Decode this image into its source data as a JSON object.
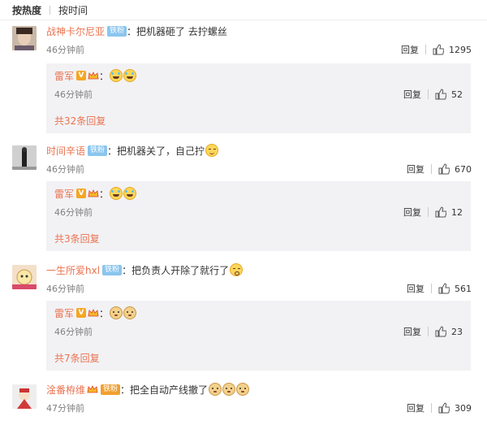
{
  "sort": {
    "hot": "按热度",
    "time": "按时间"
  },
  "comments": [
    {
      "user": "战神卡尔尼亚",
      "badge": "铁粉",
      "colon": "：",
      "text": "把机器砸了 去拧螺丝",
      "time": "46分钟前",
      "reply_label": "回复",
      "likes": "1295",
      "reply": {
        "user": "雷军",
        "colon": "：",
        "time": "46分钟前",
        "reply_label": "回复",
        "likes": "52",
        "emoji": [
          "laugh",
          "laugh"
        ]
      },
      "more": "共32条回复"
    },
    {
      "user": "时间辛语",
      "badge": "铁粉",
      "colon": "：",
      "text": "把机器关了，自己拧",
      "time": "46分钟前",
      "reply_label": "回复",
      "likes": "670",
      "reply": {
        "user": "雷军",
        "colon": "：",
        "time": "46分钟前",
        "reply_label": "回复",
        "likes": "12",
        "emoji": [
          "laugh",
          "laugh"
        ]
      },
      "more": "共3条回复"
    },
    {
      "user": "一生所爱hxl",
      "badge": "铁粉",
      "colon": "：",
      "text": "把负责人开除了就行了",
      "time": "46分钟前",
      "reply_label": "回复",
      "likes": "561",
      "reply": {
        "user": "雷军",
        "colon": "：",
        "time": "46分钟前",
        "reply_label": "回复",
        "likes": "23",
        "emoji": [
          "doge",
          "doge"
        ]
      },
      "more": "共7条回复"
    },
    {
      "user": "淦番栫维",
      "badge": "铁粉",
      "colon": "：",
      "text": "把全自动产线撤了",
      "time": "47分钟前",
      "reply_label": "回复",
      "likes": "309"
    }
  ],
  "colors": {
    "username": "#eb7350",
    "badge": "#8ac5ee",
    "reply_bg": "#f2f2f5",
    "time": "#808080"
  }
}
